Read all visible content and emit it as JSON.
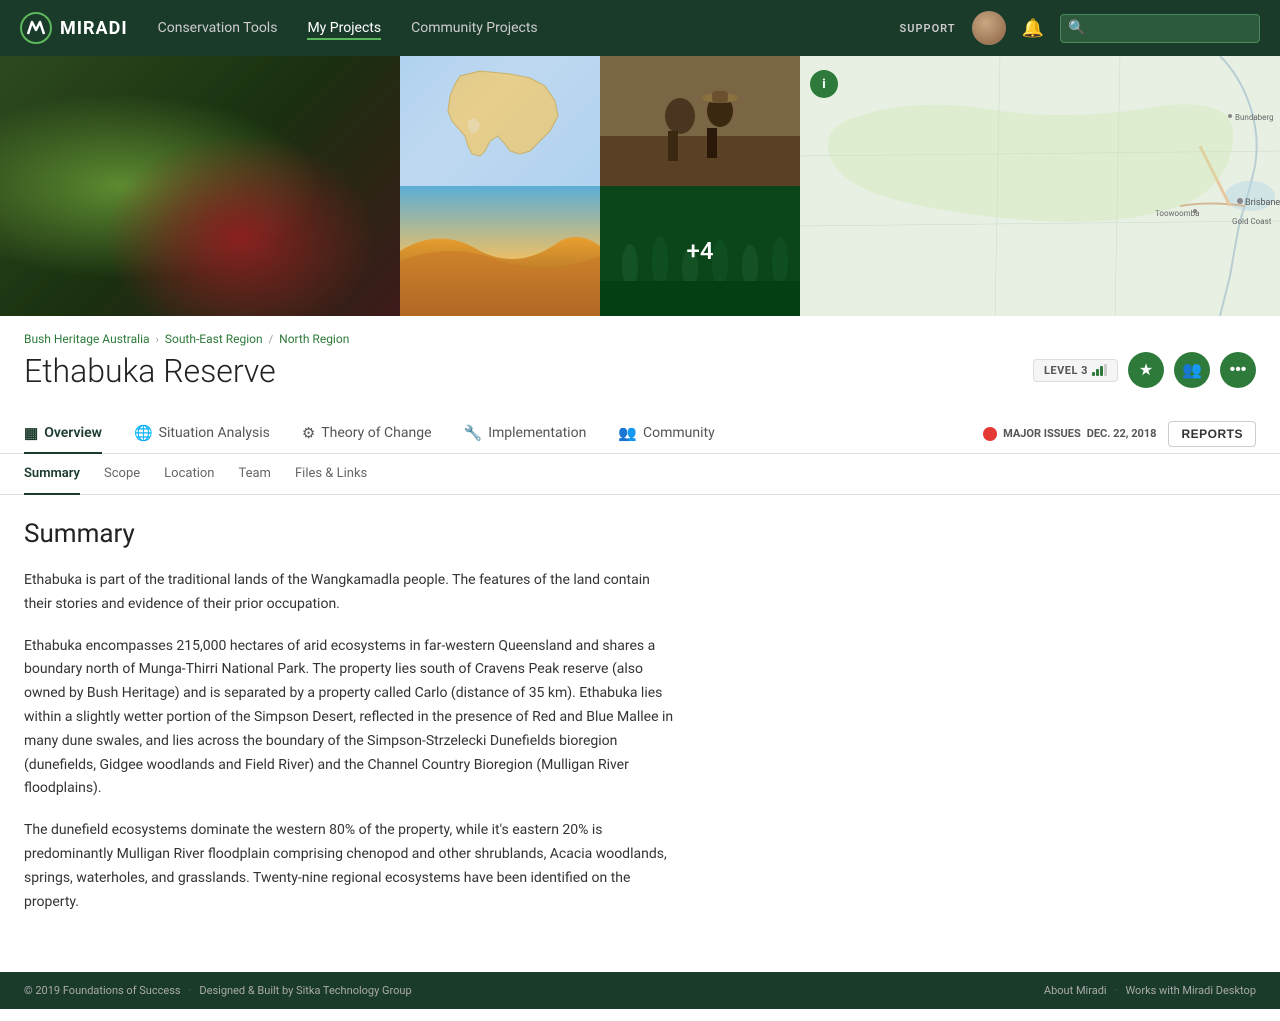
{
  "navbar": {
    "logo_text": "MIRADI",
    "links": [
      {
        "id": "conservation-tools",
        "label": "Conservation Tools",
        "active": false
      },
      {
        "id": "my-projects",
        "label": "My Projects",
        "active": true
      },
      {
        "id": "community-projects",
        "label": "Community Projects",
        "active": false
      }
    ],
    "support_label": "SUPPORT",
    "search_placeholder": ""
  },
  "breadcrumb": {
    "items": [
      {
        "id": "bush-heritage",
        "label": "Bush Heritage Australia"
      },
      {
        "id": "south-east-region",
        "label": "South-East Region"
      },
      {
        "id": "north-region",
        "label": "North Region"
      }
    ]
  },
  "project": {
    "title": "Ethabuka Reserve",
    "level_label": "LEVEL 3"
  },
  "tabs": [
    {
      "id": "overview",
      "label": "Overview",
      "icon": "▦",
      "active": true
    },
    {
      "id": "situation-analysis",
      "label": "Situation Analysis",
      "icon": "🌐",
      "active": false
    },
    {
      "id": "theory-of-change",
      "label": "Theory of Change",
      "icon": "⚙",
      "active": false
    },
    {
      "id": "implementation",
      "label": "Implementation",
      "icon": "🔧",
      "active": false
    },
    {
      "id": "community",
      "label": "Community",
      "icon": "👥",
      "active": false
    }
  ],
  "major_issues": {
    "label": "MAJOR ISSUES",
    "date": "DEC. 22, 2018"
  },
  "reports_btn": "REPORTS",
  "sub_tabs": [
    {
      "id": "summary",
      "label": "Summary",
      "active": true
    },
    {
      "id": "scope",
      "label": "Scope",
      "active": false
    },
    {
      "id": "location",
      "label": "Location",
      "active": false
    },
    {
      "id": "team",
      "label": "Team",
      "active": false
    },
    {
      "id": "files-links",
      "label": "Files & Links",
      "active": false
    }
  ],
  "summary": {
    "title": "Summary",
    "paragraphs": [
      "Ethabuka is part of the traditional lands of the Wangkamadla people. The features of the land contain their stories and evidence of their prior occupation.",
      "Ethabuka encompasses 215,000 hectares of arid ecosystems in far-western Queensland and shares a boundary north of Munga-Thirri National Park.  The property lies south of Cravens Peak reserve (also owned by Bush Heritage) and is separated by a property called Carlo (distance of 35 km).  Ethabuka lies within a slightly wetter portion of the Simpson Desert, reflected in the presence of Red and Blue Mallee in many dune swales, and lies across the boundary of the Simpson-Strzelecki Dunefields bioregion (dunefields, Gidgee woodlands and Field River) and the Channel Country Bioregion (Mulligan River floodplains).",
      "The dunefield ecosystems dominate the western 80% of the property, while it's eastern 20% is predominantly Mulligan River floodplain comprising chenopod and other shrublands, Acacia woodlands, springs, waterholes, and grasslands. Twenty-nine regional ecosystems have been identified on the property."
    ]
  },
  "hero_overlay": "+4",
  "footer": {
    "copyright": "© 2019 Foundations of Success",
    "built_by": "Designed & Built by Sitka Technology Group",
    "links": [
      "About Miradi",
      "Works with Miradi Desktop"
    ]
  }
}
